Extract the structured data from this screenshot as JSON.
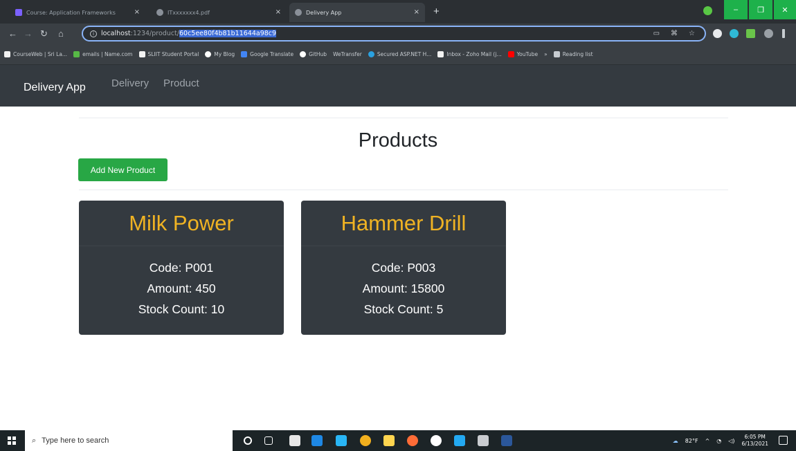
{
  "browser": {
    "tabs": [
      {
        "title": "Course: Application Frameworks",
        "color": "#7b61ff"
      },
      {
        "title": "ITxxxxxxx4.pdf",
        "color": "#8a9099"
      },
      {
        "title": "Delivery App",
        "color": "#8a9099"
      }
    ],
    "new_tab": "+",
    "close_tab": "×",
    "url_host": "localhost",
    "url_path": ":1234/product/",
    "url_id": "60c5ee80f4b81b11644a98c9",
    "bookmarks": [
      {
        "label": "CourseWeb | Sri La...",
        "color": "#f2f2f2"
      },
      {
        "label": "emails | Name.com",
        "color": "#57b846"
      },
      {
        "label": "SLIIT Student Portal",
        "color": "#f2f2f2"
      },
      {
        "label": "My Blog",
        "color": "#ffffff"
      },
      {
        "label": "Google Translate",
        "color": "#4285f4"
      },
      {
        "label": "GitHub",
        "color": "#ffffff"
      },
      {
        "label": "WeTransfer",
        "color": "#3a3f44"
      },
      {
        "label": "Secured ASP.NET H...",
        "color": "#2aa1e0"
      },
      {
        "label": "Inbox - Zoho Mail (j...",
        "color": "#f2f2f2"
      },
      {
        "label": "YouTube",
        "color": "#ff0000"
      },
      {
        "label": "»",
        "color": "#3a3f44"
      },
      {
        "label": "Reading list",
        "color": "#c7ccd1"
      }
    ]
  },
  "app": {
    "brand": "Delivery App",
    "nav": [
      "Delivery",
      "Product"
    ],
    "page_title": "Products",
    "add_button": "Add New Product",
    "products": [
      {
        "name": "Milk Power",
        "code": "Code: P001",
        "amount": "Amount: 450",
        "stock": "Stock Count: 10"
      },
      {
        "name": "Hammer Drill",
        "code": "Code: P003",
        "amount": "Amount: 15800",
        "stock": "Stock Count: 5"
      }
    ]
  },
  "taskbar": {
    "search_placeholder": "Type here to search",
    "weather": "82°F",
    "time": "6:05 PM",
    "date": "6/13/2021"
  },
  "colors": {
    "navbar": "#343a40",
    "card_title": "#f0b323",
    "button": "#28a745"
  }
}
